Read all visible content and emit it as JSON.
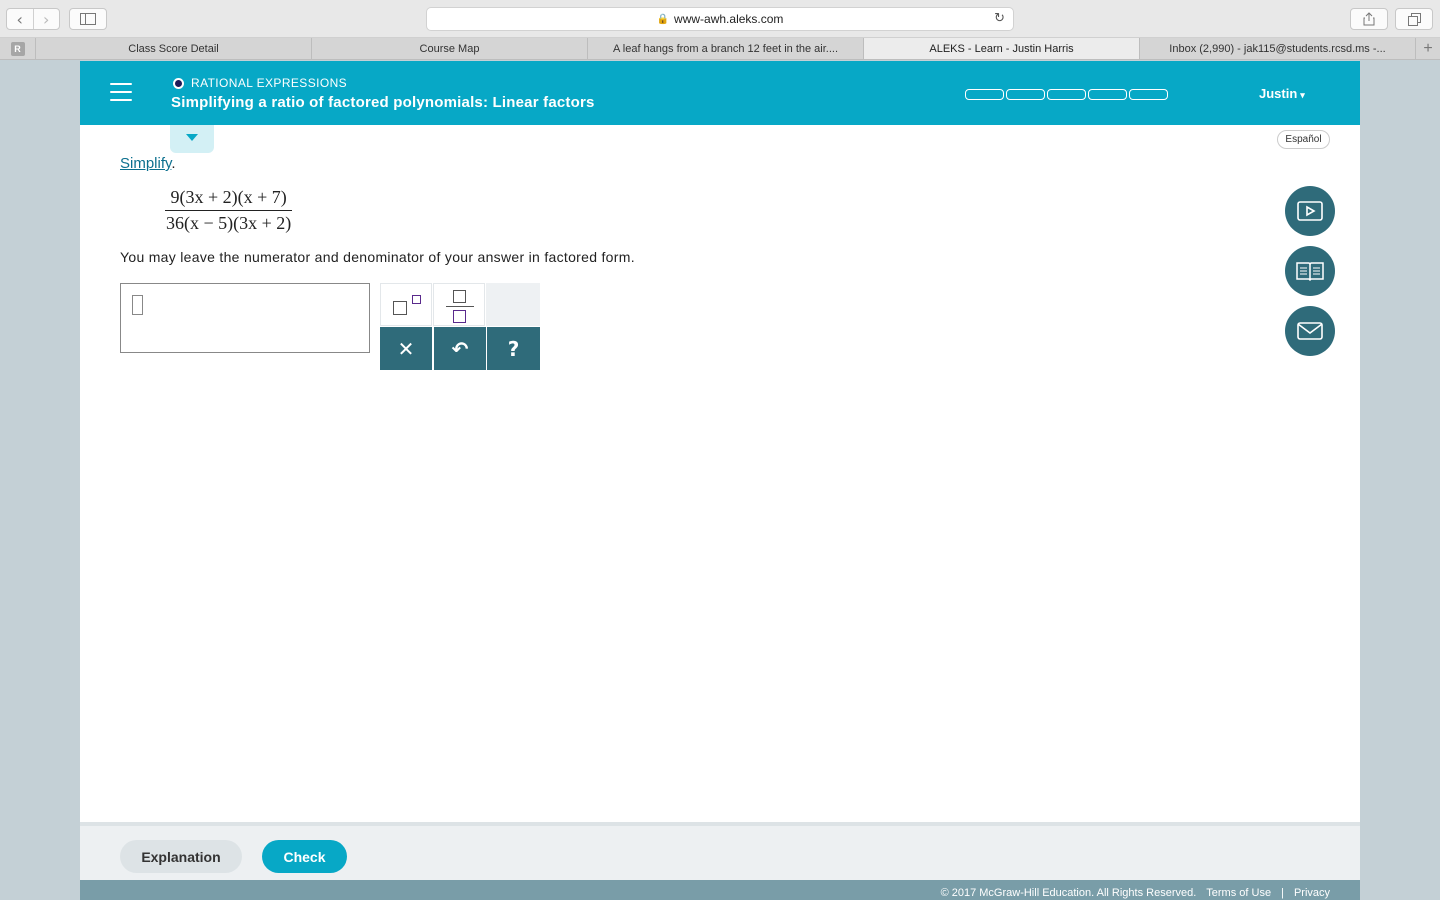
{
  "browser": {
    "url": "www-awh.aleks.com",
    "favicon_letter": "R",
    "tabs": [
      {
        "title": "Class Score Detail"
      },
      {
        "title": "Course Map"
      },
      {
        "title": "A leaf hangs from a branch 12 feet in the air...."
      },
      {
        "title": "ALEKS - Learn - Justin Harris"
      },
      {
        "title": "Inbox (2,990) - jak115@students.rcsd.ms -..."
      }
    ],
    "add_tab": "+"
  },
  "header": {
    "topic": "RATIONAL EXPRESSIONS",
    "title": "Simplifying a ratio of factored polynomials: Linear factors",
    "progress_segments": 5,
    "user": "Justin",
    "user_caret": "▾"
  },
  "language_button": "Español",
  "problem": {
    "prompt_link": "Simplify",
    "prompt_punct": ".",
    "numerator": "9(3x + 2)(x + 7)",
    "denominator": "36(x − 5)(3x + 2)",
    "instruction": "You may leave the numerator and denominator of your answer in factored form."
  },
  "keypad": {
    "clear": "✕",
    "undo": "↶",
    "help": "?"
  },
  "footer": {
    "explanation_label": "Explanation",
    "check_label": "Check",
    "copyright": "© 2017 McGraw-Hill Education. All Rights Reserved.",
    "terms": "Terms of Use",
    "separator": "|",
    "privacy": "Privacy"
  }
}
